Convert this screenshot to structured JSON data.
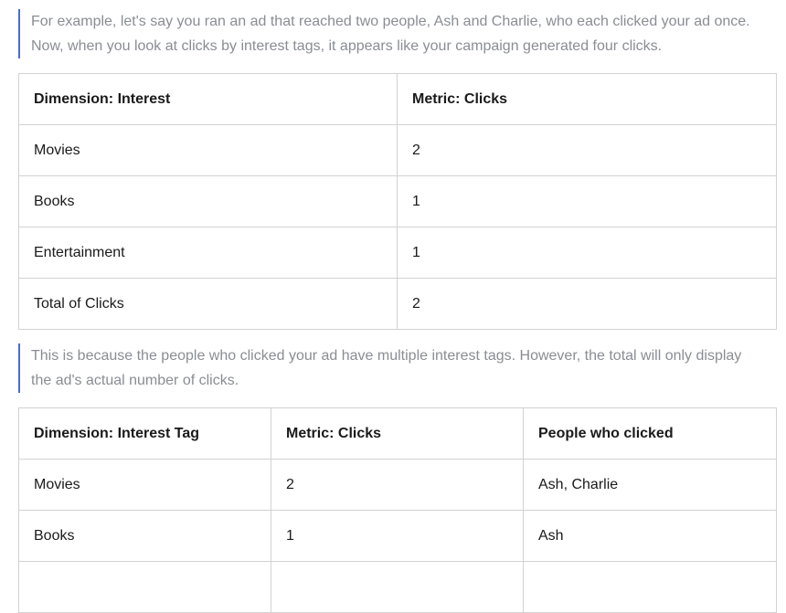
{
  "accent_color": "#4a6bd8",
  "quote1": {
    "line1": "For example, let's say you ran an ad that reached two people, Ash and Charlie, who each clicked your ad once.",
    "line2": "Now, when you look at clicks by interest tags, it appears like your campaign generated four clicks."
  },
  "table1": {
    "headers": [
      "Dimension: Interest",
      "Metric: Clicks"
    ],
    "rows": [
      [
        "Movies",
        "2"
      ],
      [
        "Books",
        "1"
      ],
      [
        "Entertainment",
        "1"
      ],
      [
        "Total of Clicks",
        "2"
      ]
    ]
  },
  "quote2": {
    "line1": "This is because the people who clicked your ad have multiple interest tags. However, the total will only display",
    "line2": "the ad's actual number of clicks."
  },
  "table2": {
    "headers": [
      "Dimension: Interest Tag",
      "Metric: Clicks",
      "People who clicked"
    ],
    "rows": [
      [
        "Movies",
        "2",
        "Ash, Charlie"
      ],
      [
        "Books",
        "1",
        "Ash"
      ],
      [
        "",
        "",
        ""
      ]
    ]
  }
}
